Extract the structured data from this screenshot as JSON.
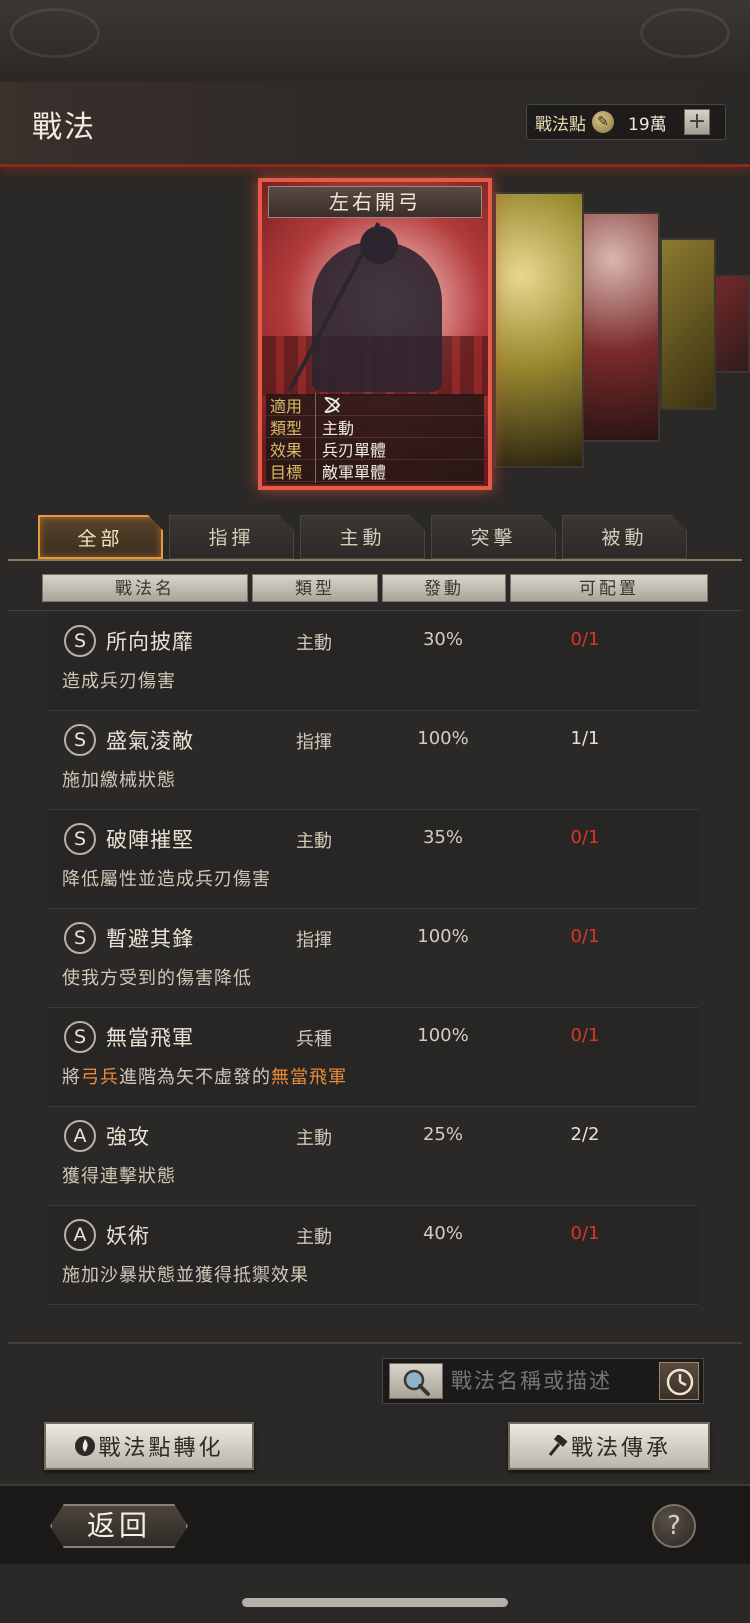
{
  "header": {
    "title": "戰法",
    "points_label": "戰法點",
    "points_value": "19萬",
    "plus_label": "+"
  },
  "card": {
    "title": "左右開弓",
    "rows": [
      {
        "key": "適用",
        "value": ""
      },
      {
        "key": "類型",
        "value": "主動"
      },
      {
        "key": "效果",
        "value": "兵刃單體"
      },
      {
        "key": "目標",
        "value": "敵軍單體"
      }
    ],
    "applies_icon": "bow-icon"
  },
  "tabs": [
    {
      "label": "全部",
      "active": true
    },
    {
      "label": "指揮",
      "active": false
    },
    {
      "label": "主動",
      "active": false
    },
    {
      "label": "突擊",
      "active": false
    },
    {
      "label": "被動",
      "active": false
    }
  ],
  "columns": [
    "戰法名",
    "類型",
    "發動",
    "可配置"
  ],
  "tactics": [
    {
      "grade": "S",
      "name": "所向披靡",
      "type": "主動",
      "rate": "30%",
      "slots": "0/1",
      "slots_full": false,
      "desc": "造成兵刃傷害"
    },
    {
      "grade": "S",
      "name": "盛氣淩敵",
      "type": "指揮",
      "rate": "100%",
      "slots": "1/1",
      "slots_full": true,
      "desc": "施加繳械狀態"
    },
    {
      "grade": "S",
      "name": "破陣摧堅",
      "type": "主動",
      "rate": "35%",
      "slots": "0/1",
      "slots_full": false,
      "desc": "降低屬性並造成兵刃傷害"
    },
    {
      "grade": "S",
      "name": "暫避其鋒",
      "type": "指揮",
      "rate": "100%",
      "slots": "0/1",
      "slots_full": false,
      "desc": "使我方受到的傷害降低"
    },
    {
      "grade": "S",
      "name": "無當飛軍",
      "type": "兵種",
      "rate": "100%",
      "slots": "0/1",
      "slots_full": false,
      "desc_parts": [
        "將",
        "弓兵",
        "進階為矢不虛發的",
        "無當飛軍"
      ]
    },
    {
      "grade": "A",
      "name": "強攻",
      "type": "主動",
      "rate": "25%",
      "slots": "2/2",
      "slots_full": true,
      "desc": "獲得連擊狀態"
    },
    {
      "grade": "A",
      "name": "妖術",
      "type": "主動",
      "rate": "40%",
      "slots": "0/1",
      "slots_full": false,
      "desc": "施加沙暴狀態並獲得抵禦效果"
    }
  ],
  "search": {
    "placeholder": "戰法名稱或描述",
    "icon": "magnifier-icon",
    "history_icon": "clock-icon"
  },
  "buttons": {
    "convert": "戰法點轉化",
    "inherit": "戰法傳承"
  },
  "footer": {
    "back": "返回",
    "help": "?"
  },
  "colors": {
    "accent_red": "#d83628",
    "highlight_orange": "#e88a3a",
    "tab_active_border": "#e89a3a"
  }
}
